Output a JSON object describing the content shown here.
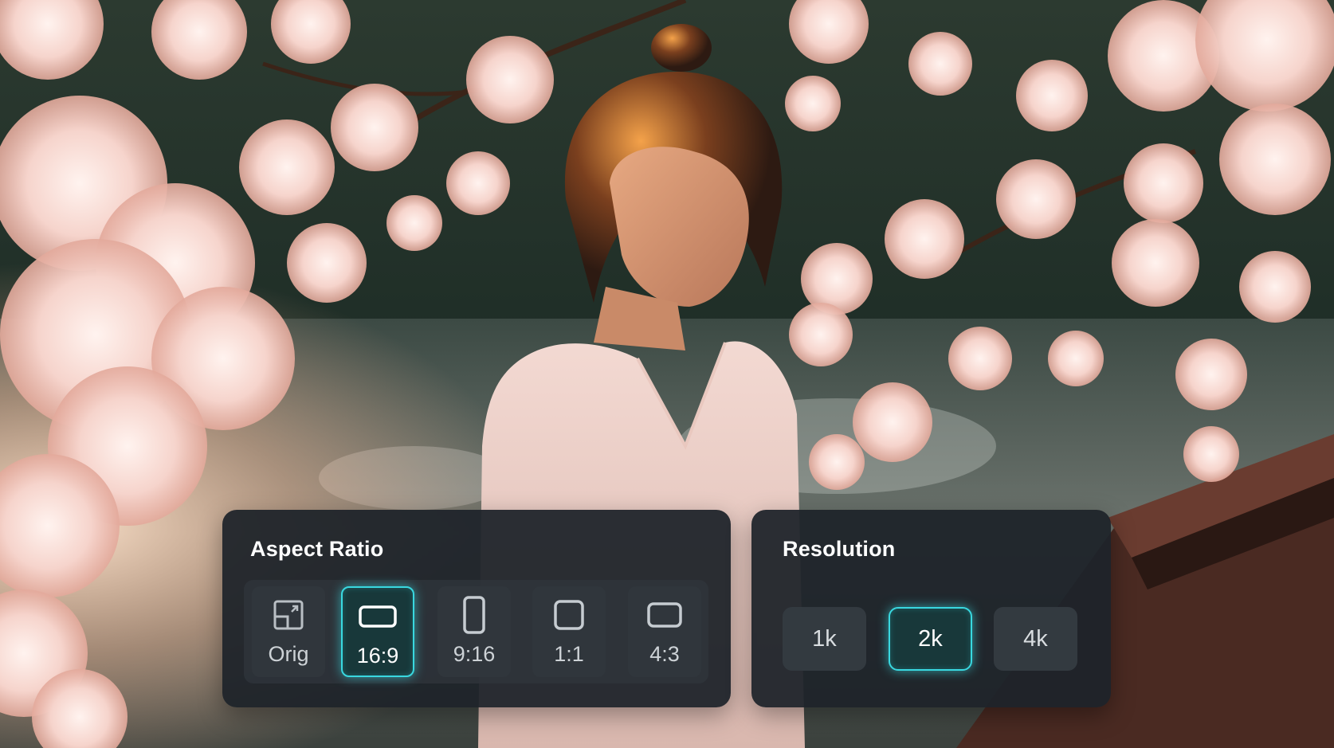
{
  "aspect_ratio": {
    "title": "Aspect Ratio",
    "options": [
      {
        "label": "Orig",
        "icon": "orig-crop-icon",
        "selected": false
      },
      {
        "label": "16:9",
        "icon": "landscape-rect-icon",
        "selected": true
      },
      {
        "label": "9:16",
        "icon": "portrait-rect-icon",
        "selected": false
      },
      {
        "label": "1:1",
        "icon": "square-icon",
        "selected": false
      },
      {
        "label": "4:3",
        "icon": "wide-rect-icon",
        "selected": false
      }
    ]
  },
  "resolution": {
    "title": "Resolution",
    "options": [
      {
        "label": "1k",
        "selected": false
      },
      {
        "label": "2k",
        "selected": true
      },
      {
        "label": "4k",
        "selected": false
      }
    ]
  },
  "colors": {
    "accent": "#39d8e0",
    "panel_bg": "#1e2329",
    "option_bg": "#30363c"
  }
}
